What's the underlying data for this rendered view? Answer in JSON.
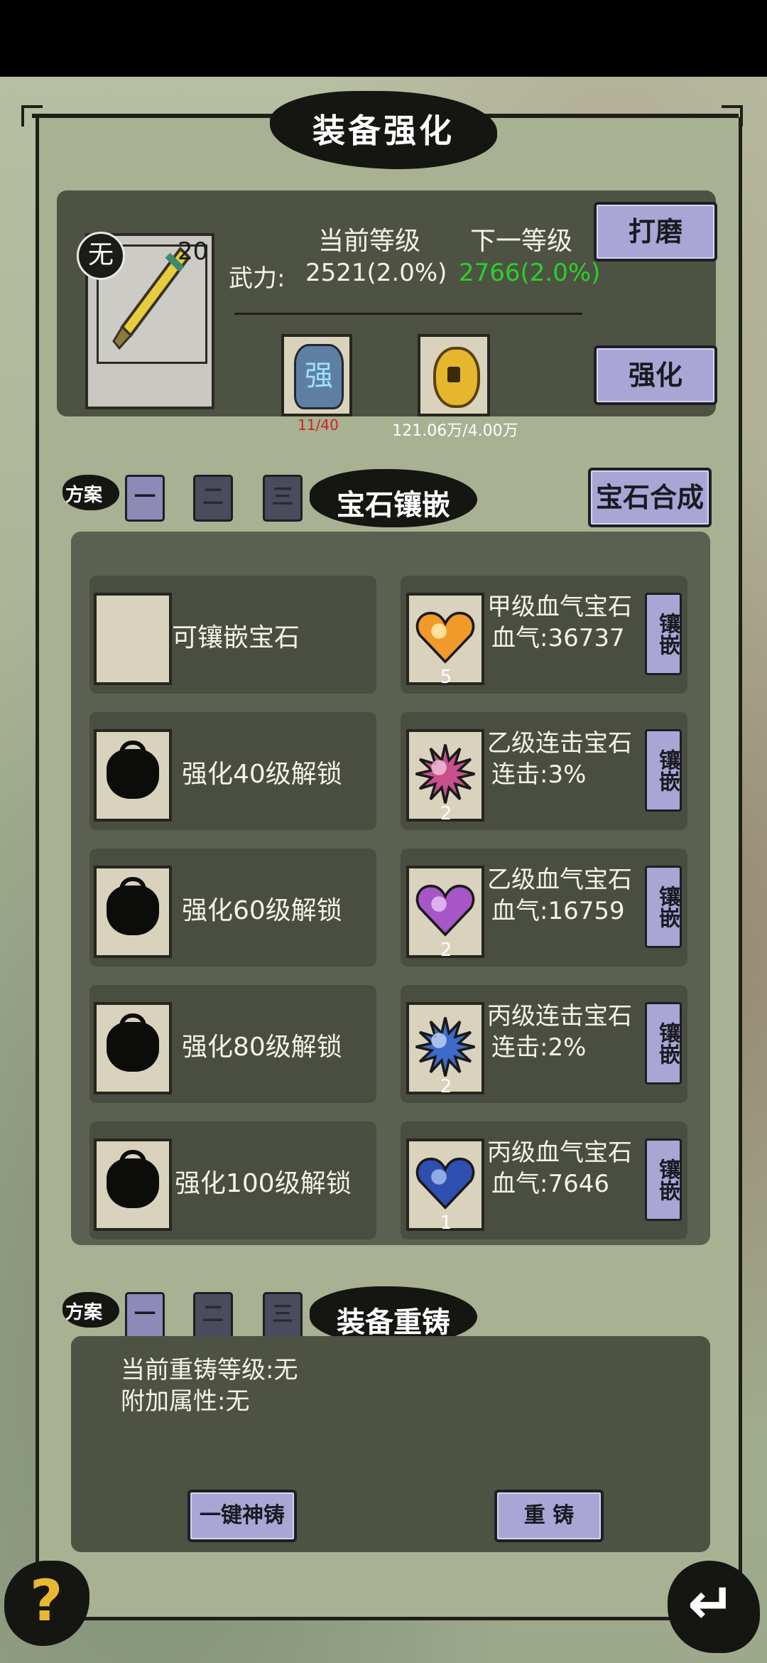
{
  "title": "装备强化",
  "equipment": {
    "quality_badge": "无",
    "level": "20",
    "current_header": "当前等级",
    "next_header": "下一等级",
    "stat_label": "武力:",
    "current_value": "2521(2.0%)",
    "next_value": "2766(2.0%)",
    "next_value_color": "#28d12a",
    "polish_button": "打磨",
    "enhance_button": "强化",
    "material_stone_glyph": "强",
    "material_stone_count": "11/40",
    "material_stone_count_color": "#d22020",
    "material_coin_count": "121.06万/4.00万"
  },
  "gem_section": {
    "scheme_label": "方案",
    "tabs": [
      "一",
      "二",
      "三"
    ],
    "title": "宝石镶嵌",
    "synth_button": "宝石合成",
    "slots": [
      {
        "label": "可镶嵌宝石",
        "locked": false
      },
      {
        "label": "强化40级解锁",
        "locked": true
      },
      {
        "label": "强化60级解锁",
        "locked": true
      },
      {
        "label": "强化80级解锁",
        "locked": true
      },
      {
        "label": "强化100级解锁",
        "locked": true
      }
    ],
    "gems": [
      {
        "name": "甲级血气宝石",
        "stat": "血气:36737",
        "count": "5",
        "shape": "heart-orange",
        "action": "镶嵌"
      },
      {
        "name": "乙级连击宝石",
        "stat": "连击:3%",
        "count": "2",
        "shape": "star-pink",
        "action": "镶嵌"
      },
      {
        "name": "乙级血气宝石",
        "stat": "血气:16759",
        "count": "2",
        "shape": "heart-purple",
        "action": "镶嵌"
      },
      {
        "name": "丙级连击宝石",
        "stat": "连击:2%",
        "count": "2",
        "shape": "star-blue",
        "action": "镶嵌"
      },
      {
        "name": "丙级血气宝石",
        "stat": "血气:7646",
        "count": "1",
        "shape": "heart-blue",
        "action": "镶嵌"
      }
    ]
  },
  "recast_section": {
    "scheme_label": "方案",
    "tabs": [
      "一",
      "二",
      "三"
    ],
    "title": "装备重铸",
    "current_level": "当前重铸等级:无",
    "extra_attr": "附加属性:无",
    "one_key_button": "一键神铸",
    "recast_button": "重 铸"
  },
  "footer": {
    "help_glyph": "?",
    "back_glyph": "↵"
  }
}
